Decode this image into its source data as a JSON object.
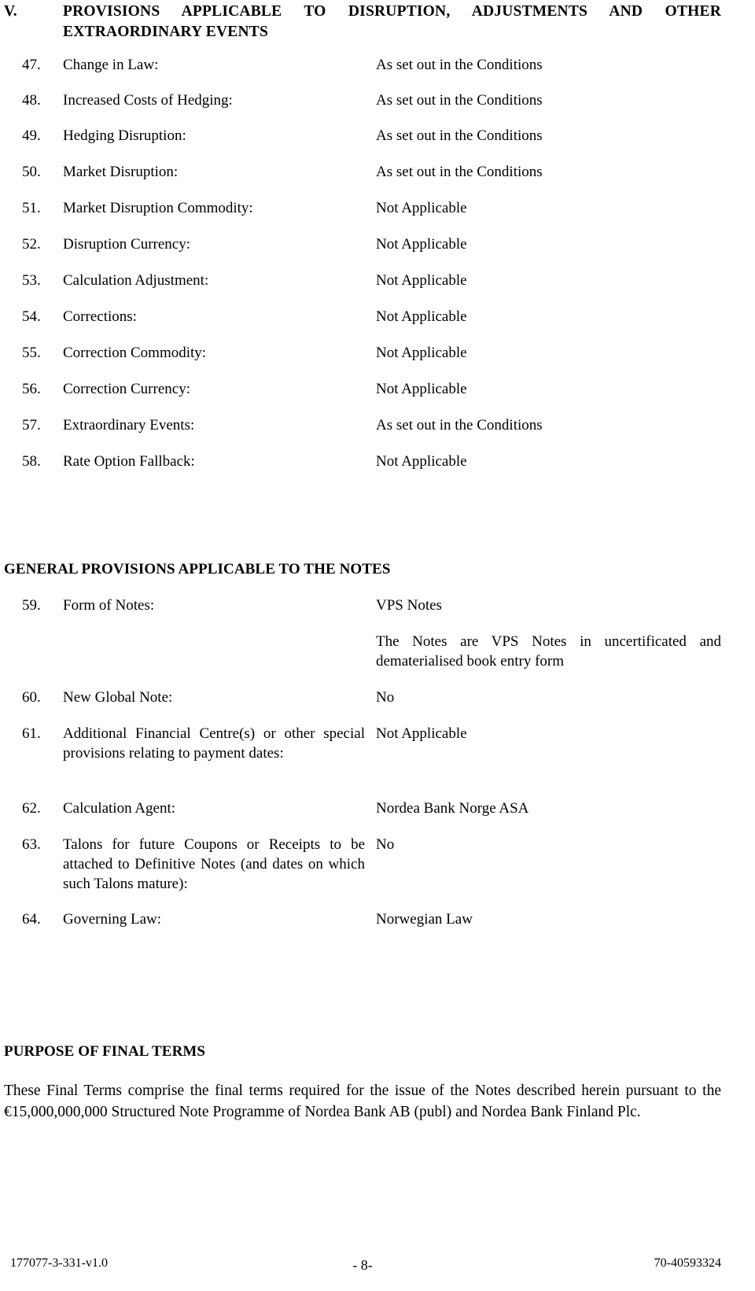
{
  "document": {
    "section_heading": {
      "number": "V.",
      "text": "PROVISIONS APPLICABLE TO DISRUPTION, ADJUSTMENTS AND OTHER EXTRAORDINARY EVENTS"
    },
    "provisions_disruption": [
      {
        "number": "47.",
        "label": "Change in Law:",
        "value": "As set out in the Conditions"
      },
      {
        "number": "48.",
        "label": "Increased Costs of Hedging:",
        "value": "As set out in the Conditions"
      },
      {
        "number": "49.",
        "label": "Hedging Disruption:",
        "value": "As set out in the Conditions"
      },
      {
        "number": "50.",
        "label": "Market Disruption:",
        "value": "As set out in the Conditions"
      },
      {
        "number": "51.",
        "label": "Market Disruption Commodity:",
        "value": "Not Applicable"
      },
      {
        "number": "52.",
        "label": "Disruption Currency:",
        "value": "Not Applicable"
      },
      {
        "number": "53.",
        "label": "Calculation Adjustment:",
        "value": "Not Applicable"
      },
      {
        "number": "54.",
        "label": "Corrections:",
        "value": "Not Applicable"
      },
      {
        "number": "55.",
        "label": "Correction Commodity:",
        "value": "Not Applicable"
      },
      {
        "number": "56.",
        "label": "Correction Currency:",
        "value": "Not Applicable"
      },
      {
        "number": "57.",
        "label": "Extraordinary Events:",
        "value": "As set out in the Conditions"
      },
      {
        "number": "58.",
        "label": "Rate Option Fallback:",
        "value": "Not Applicable"
      }
    ],
    "general_provisions_heading": "GENERAL PROVISIONS APPLICABLE TO THE NOTES",
    "provisions_general": [
      {
        "number": "59.",
        "label": "Form of Notes:",
        "value": "VPS Notes"
      },
      {
        "number": "60.",
        "label": "New Global Note:",
        "value": "No"
      },
      {
        "number": "61.",
        "label": "Additional Financial Centre(s) or other special provisions relating to payment dates:",
        "value": "Not Applicable"
      },
      {
        "number": "62.",
        "label": "Calculation Agent:",
        "value": "Nordea Bank Norge ASA"
      },
      {
        "number": "63.",
        "label": "Talons for future Coupons or Receipts to be attached to Definitive Notes (and dates on which such Talons mature):",
        "value": "No"
      },
      {
        "number": "64.",
        "label": "Governing Law:",
        "value": "Norwegian Law"
      }
    ],
    "form_of_notes_detail": "The Notes are VPS Notes in uncertificated and dematerialised book entry form",
    "purpose_heading": "PURPOSE OF FINAL TERMS",
    "purpose_paragraph": "These Final Terms comprise the final terms required for the issue of the Notes described herein pursuant to the €15,000,000,000 Structured Note Programme of Nordea Bank AB (publ) and Nordea Bank Finland Plc.",
    "footer": {
      "left": "177077-3-331-v1.0",
      "center": "- 8-",
      "right": "70-40593324"
    }
  }
}
